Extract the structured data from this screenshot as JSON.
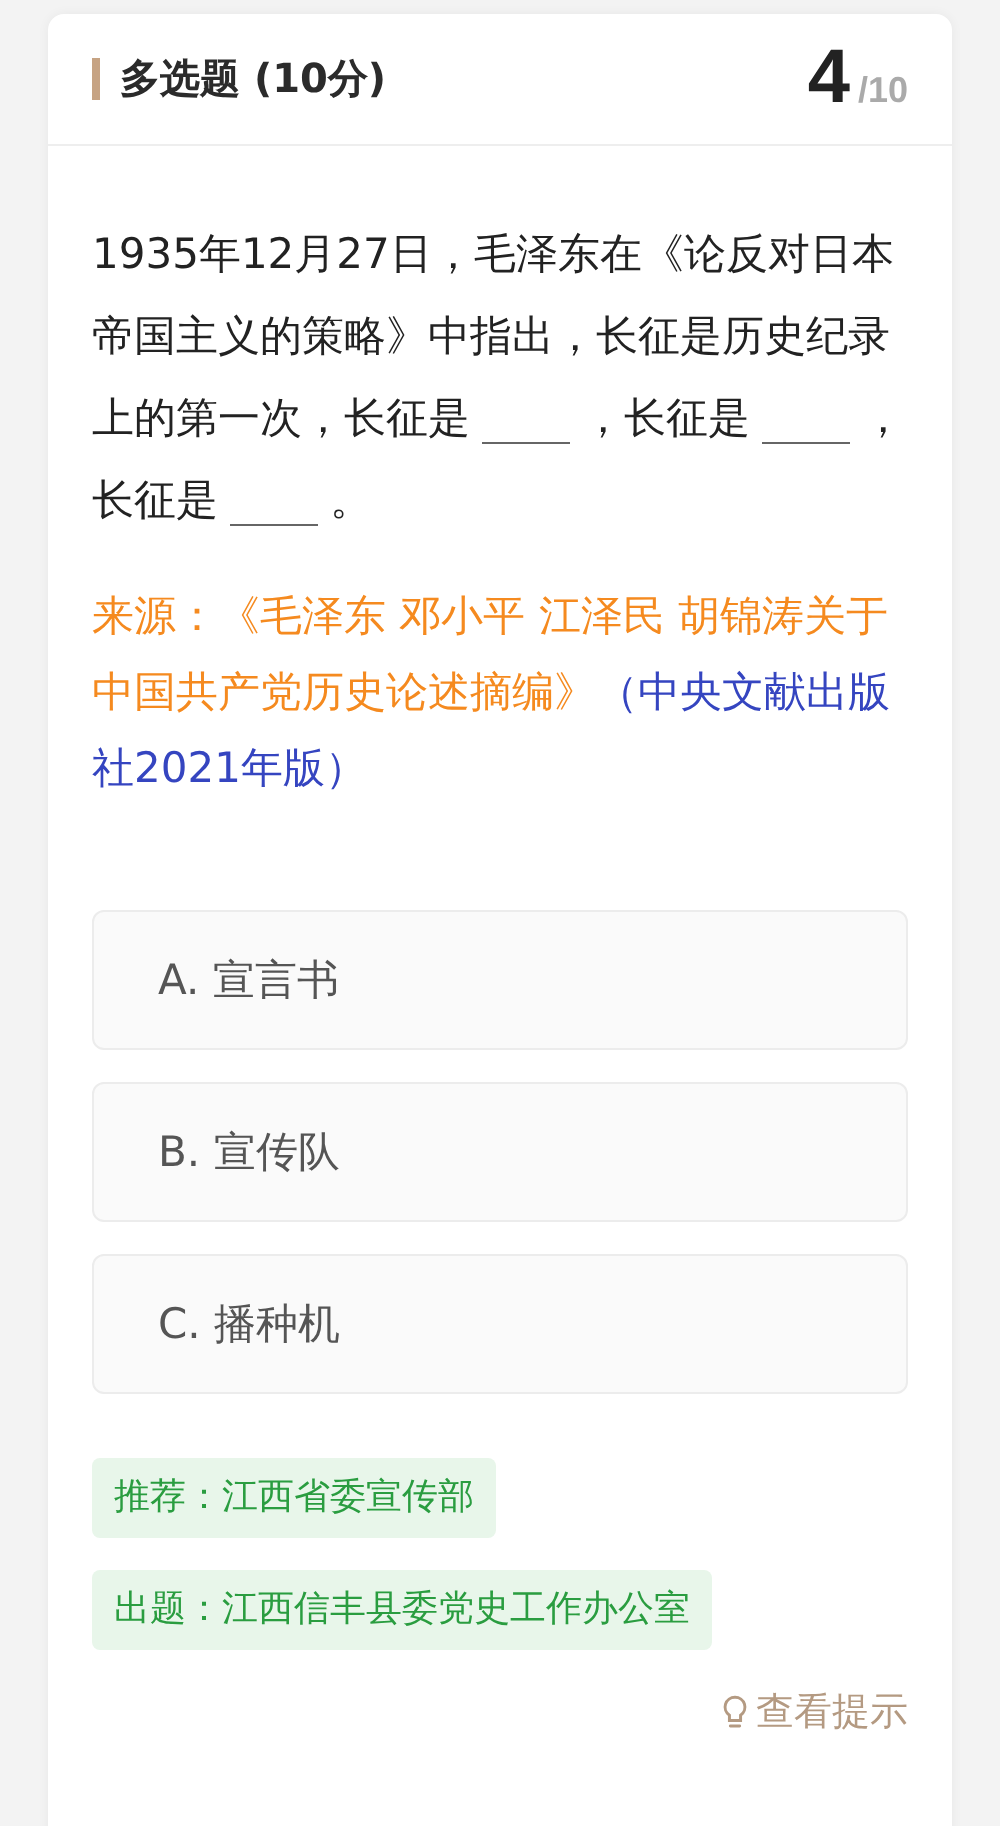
{
  "header": {
    "type": "多选题 (10分)",
    "current": "4",
    "total": "/10"
  },
  "question": [
    {
      "kind": "text",
      "text": "1935年12月27日，毛泽东在《论反对日本帝国主义的策略》中指出，长征是历史纪录上的第一次，长征是"
    },
    {
      "kind": "blank"
    },
    {
      "kind": "text",
      "text": "，长征是"
    },
    {
      "kind": "blank"
    },
    {
      "kind": "text",
      "text": "，长征是"
    },
    {
      "kind": "blank"
    },
    {
      "kind": "text",
      "text": "。"
    }
  ],
  "source": [
    {
      "kind": "title",
      "text": "来源：《毛泽东 邓小平 江泽民 胡锦涛关于中国共产党历史论述摘编》"
    },
    {
      "kind": "publisher",
      "text": "（中央文献出版社2021年版）"
    }
  ],
  "options": [
    {
      "label": "A. 宣言书",
      "selected": false
    },
    {
      "label": "B. 宣传队",
      "selected": false
    },
    {
      "label": "C. 播种机",
      "selected": false
    }
  ],
  "tags": [
    "推荐：江西省委宣传部",
    "出题：江西信丰县委党史工作办公室"
  ],
  "hint": "查看提示"
}
